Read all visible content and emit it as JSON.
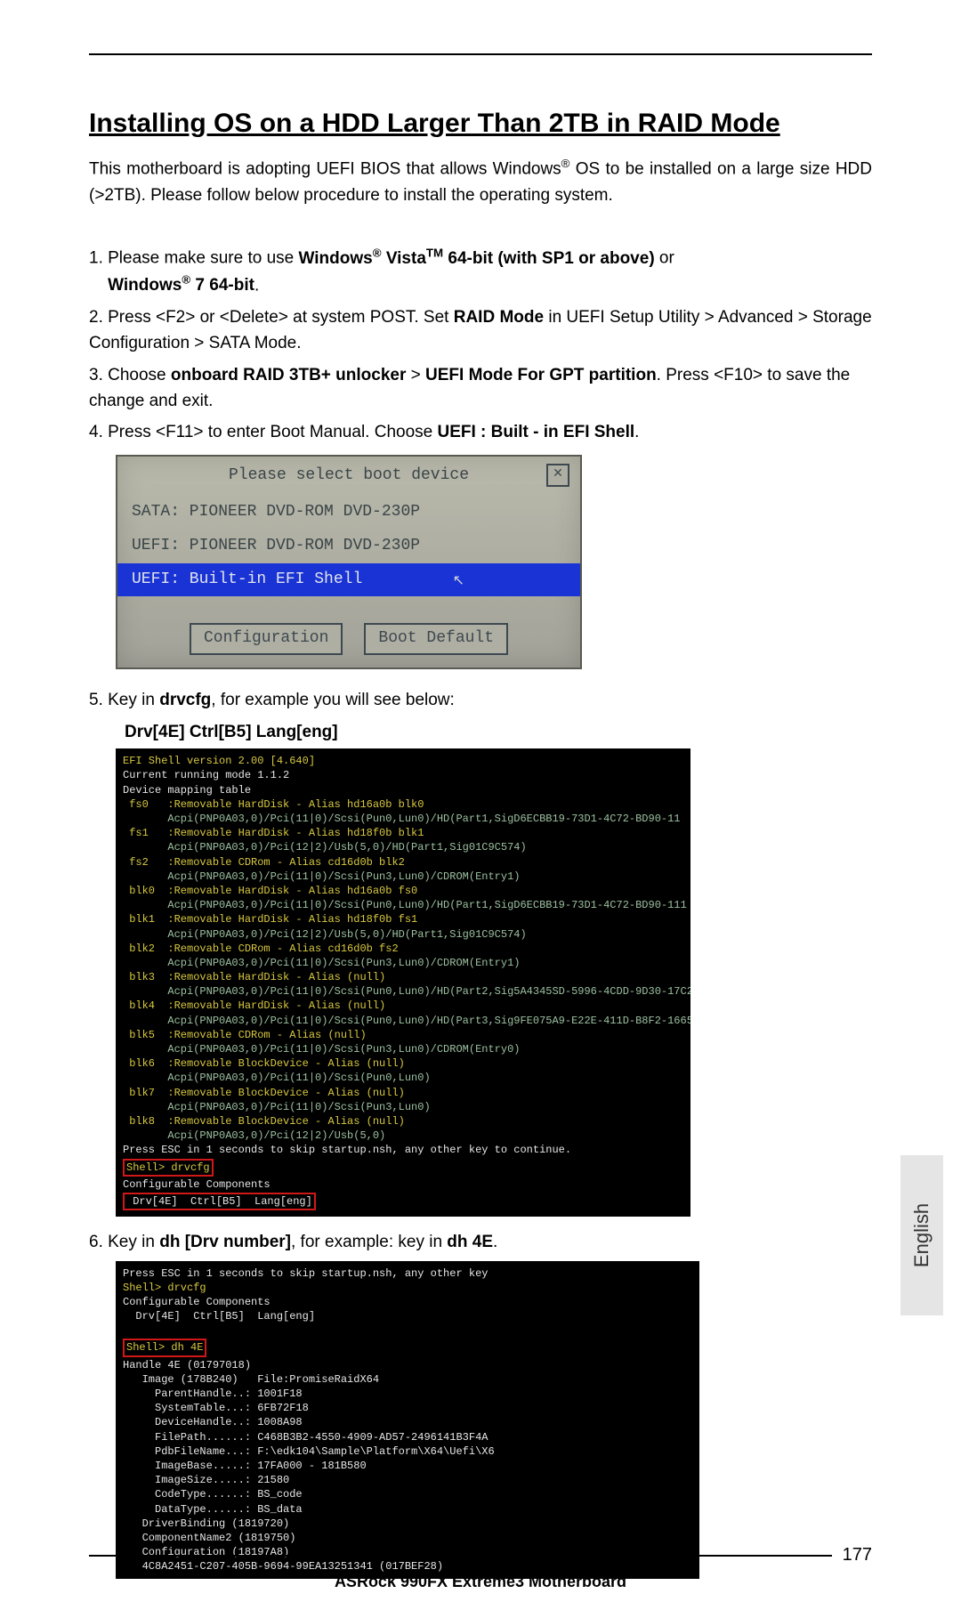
{
  "section_title": "Installing OS on a HDD Larger Than 2TB in RAID Mode",
  "intro_pre": "This motherboard is adopting UEFI BIOS that allows Windows",
  "intro_post": " OS to be installed on a large size HDD (>2TB). Please follow below procedure to install the operating system.",
  "step1_a": "1. Please make sure to use ",
  "step1_b1": "Windows",
  "step1_b2": " Vista",
  "step1_b3": " 64-bit (with SP1 or above)",
  "step1_c": " or ",
  "step1_d1": "Windows",
  "step1_d2": " 7 64-bit",
  "step1_e": ".",
  "step2_a": "2. Press <F2> or <Delete> at system POST. Set ",
  "step2_b": "RAID Mode",
  "step2_c": " in UEFI Setup Utility > Advanced > Storage Configuration > SATA Mode.",
  "step3_a": "3. Choose ",
  "step3_b": "onboard RAID 3TB+ unlocker",
  "step3_c": " > ",
  "step3_d": "UEFI Mode For GPT partition",
  "step3_e": ". Press <F10> to save the change and exit.",
  "step4_a": "4. Press <F11> to enter Boot Manual. Choose ",
  "step4_b": "UEFI : Built - in EFI Shell",
  "step4_c": ".",
  "boot": {
    "title": "Please select boot device",
    "close": "✕",
    "r1": "SATA: PIONEER DVD-ROM DVD-230P",
    "r2": "UEFI: PIONEER DVD-ROM DVD-230P",
    "r3": "UEFI: Built-in EFI Shell",
    "btn1": "Configuration",
    "btn2": "Boot Default"
  },
  "step5_a": "5. Key in ",
  "step5_b": "drvcfg",
  "step5_c": ", for example you will see below:",
  "step5_line": "Drv[4E]   Ctrl[B5]   Lang[eng]",
  "term1": {
    "l1": "EFI Shell version 2.00 [4.640]",
    "l2": "Current running mode 1.1.2",
    "l3": "Device mapping table",
    "fs0a": " fs0   :Removable HardDisk - Alias hd16a0b blk0",
    "fs0b": "       Acpi(PNP0A03,0)/Pci(11|0)/Scsi(Pun0,Lun0)/HD(Part1,SigD6ECBB19-73D1-4C72-BD90-11",
    "fs1a": " fs1   :Removable HardDisk - Alias hd18f0b blk1",
    "fs1b": "       Acpi(PNP0A03,0)/Pci(12|2)/Usb(5,0)/HD(Part1,Sig01C9C574)",
    "fs2a": " fs2   :Removable CDRom - Alias cd16d0b blk2",
    "fs2b": "       Acpi(PNP0A03,0)/Pci(11|0)/Scsi(Pun3,Lun0)/CDROM(Entry1)",
    "blk0a": " blk0  :Removable HardDisk - Alias hd16a0b fs0",
    "blk0b": "       Acpi(PNP0A03,0)/Pci(11|0)/Scsi(Pun0,Lun0)/HD(Part1,SigD6ECBB19-73D1-4C72-BD90-111",
    "blk1a": " blk1  :Removable HardDisk - Alias hd18f0b fs1",
    "blk1b": "       Acpi(PNP0A03,0)/Pci(12|2)/Usb(5,0)/HD(Part1,Sig01C9C574)",
    "blk2a": " blk2  :Removable CDRom - Alias cd16d0b fs2",
    "blk2b": "       Acpi(PNP0A03,0)/Pci(11|0)/Scsi(Pun3,Lun0)/CDROM(Entry1)",
    "blk3a": " blk3  :Removable HardDisk - Alias (null)",
    "blk3b": "       Acpi(PNP0A03,0)/Pci(11|0)/Scsi(Pun0,Lun0)/HD(Part2,Sig5A4345SD-5996-4CDD-9D30-17C2",
    "blk4a": " blk4  :Removable HardDisk - Alias (null)",
    "blk4b": "       Acpi(PNP0A03,0)/Pci(11|0)/Scsi(Pun0,Lun0)/HD(Part3,Sig9FE075A9-E22E-411D-B8F2-1665",
    "blk5a": " blk5  :Removable CDRom - Alias (null)",
    "blk5b": "       Acpi(PNP0A03,0)/Pci(11|0)/Scsi(Pun3,Lun0)/CDROM(Entry0)",
    "blk6a": " blk6  :Removable BlockDevice - Alias (null)",
    "blk6b": "       Acpi(PNP0A03,0)/Pci(11|0)/Scsi(Pun0,Lun0)",
    "blk7a": " blk7  :Removable BlockDevice - Alias (null)",
    "blk7b": "       Acpi(PNP0A03,0)/Pci(11|0)/Scsi(Pun3,Lun0)",
    "blk8a": " blk8  :Removable BlockDevice - Alias (null)",
    "blk8b": "       Acpi(PNP0A03,0)/Pci(12|2)/Usb(5,0)",
    "esc": "Press ESC in 1 seconds to skip startup.nsh, any other key to continue.",
    "shell": "Shell> drvcfg",
    "conf": "Configurable Components",
    "res": " Drv[4E]  Ctrl[B5]  Lang[eng]"
  },
  "step6_a": "6. Key in ",
  "step6_b": "dh [Drv number]",
  "step6_c": ", for example: key in ",
  "step6_d": "dh 4E",
  "step6_e": ".",
  "term2": {
    "l1": "Press ESC in 1 seconds to skip startup.nsh, any other key",
    "l2": "Shell> drvcfg",
    "l3": "Configurable Components",
    "l4": "  Drv[4E]  Ctrl[B5]  Lang[eng]",
    "blank": "",
    "l5": "Shell> dh 4E",
    "l6": "Handle 4E (01797018)",
    "l7": "   Image (178B240)   File:PromiseRaidX64",
    "l8": "     ParentHandle..: 1001F18",
    "l9": "     SystemTable...: 6FB72F18",
    "l10": "     DeviceHandle..: 1008A98",
    "l11": "     FilePath......: C468B3B2-4550-4909-AD57-2496141B3F4A",
    "l12": "     PdbFileName...: F:\\edk104\\Sample\\Platform\\X64\\Uefi\\X6",
    "l13": "     ImageBase.....: 17FA000 - 181B580",
    "l14": "     ImageSize.....: 21580",
    "l15": "     CodeType......: BS_code",
    "l16": "     DataType......: BS_data",
    "l17": "   DriverBinding (1819720)",
    "l18": "   ComponentName2 (1819750)",
    "l19": "   Configuration (18197A8)",
    "l20": "   4C8A2451-C207-405B-9694-99EA13251341 (017BEF28)"
  },
  "language": "English",
  "page_number": "177",
  "footer": "ASRock  990FX Extreme3  Motherboard"
}
